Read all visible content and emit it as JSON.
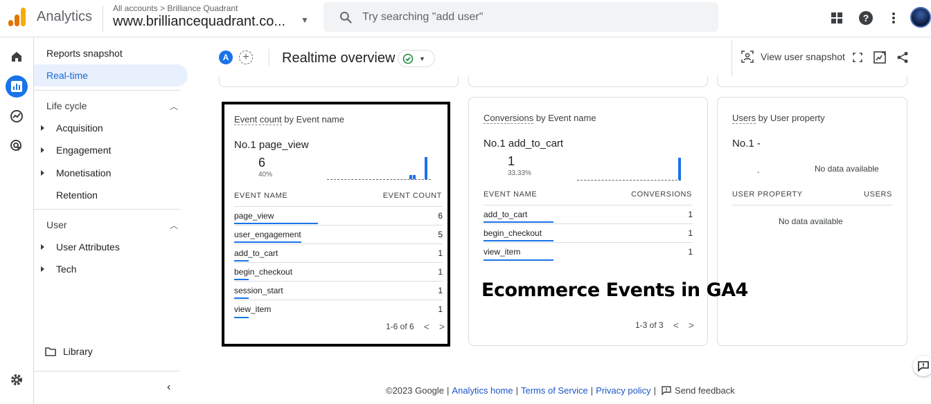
{
  "header": {
    "app_name": "Analytics",
    "breadcrumb": "All accounts > Brilliance Quadrant",
    "account": "www.brilliancequadrant.co...",
    "search_placeholder": "Try searching \"add user\"",
    "logo_colors": [
      "#f9ab00",
      "#e37400",
      "#e37400"
    ]
  },
  "sidebar": {
    "reports_snapshot": "Reports snapshot",
    "realtime": "Real-time",
    "lifecycle_heading": "Life cycle",
    "lifecycle_items": [
      "Acquisition",
      "Engagement",
      "Monetisation",
      "Retention"
    ],
    "user_heading": "User",
    "user_items": [
      "User Attributes",
      "Tech"
    ],
    "library": "Library"
  },
  "main": {
    "comparison_badge": "A",
    "title": "Realtime overview",
    "view_user_snapshot": "View user snapshot"
  },
  "cards": [
    {
      "title_metric": "Event count",
      "title_rest": " by Event name",
      "no1_label": "No.1",
      "no1_name": "page_view",
      "value": "6",
      "percent": "40%",
      "col1": "EVENT NAME",
      "col2": "EVENT COUNT",
      "rows": [
        {
          "name": "page_view",
          "value": "6",
          "share": 1.0
        },
        {
          "name": "user_engagement",
          "value": "5",
          "share": 0.8
        },
        {
          "name": "add_to_cart",
          "value": "1",
          "share": 0.17
        },
        {
          "name": "begin_checkout",
          "value": "1",
          "share": 0.17
        },
        {
          "name": "session_start",
          "value": "1",
          "share": 0.17
        },
        {
          "name": "view_item",
          "value": "1",
          "share": 0.17
        }
      ],
      "pager": "1-6 of 6"
    },
    {
      "title_metric": "Conversions",
      "title_rest": " by Event name",
      "no1_label": "No.1",
      "no1_name": "add_to_cart",
      "value": "1",
      "percent": "33.33%",
      "col1": "EVENT NAME",
      "col2": "CONVERSIONS",
      "rows": [
        {
          "name": "add_to_cart",
          "value": "1",
          "share": 1.0
        },
        {
          "name": "begin_checkout",
          "value": "1",
          "share": 1.0
        },
        {
          "name": "view_item",
          "value": "1",
          "share": 1.0
        }
      ],
      "pager": "1-3 of 3"
    },
    {
      "title_metric": "Users",
      "title_rest": " by User property",
      "no1_label": "No.1",
      "no1_name": "-",
      "value": "-",
      "no_data": "No data available",
      "col1": "USER PROPERTY",
      "col2": "USERS",
      "table_no_data": "No data available"
    }
  ],
  "overlay_text": "Ecommerce Events in GA4",
  "footer": {
    "copyright": "©2023 Google",
    "analytics_home": "Analytics home",
    "terms": "Terms of Service",
    "privacy": "Privacy policy",
    "send_feedback": "Send feedback"
  },
  "colors": {
    "accent": "#1a73e8",
    "active_nav_bg": "#e8f0fe",
    "status_ok": "#1e8e3e"
  }
}
